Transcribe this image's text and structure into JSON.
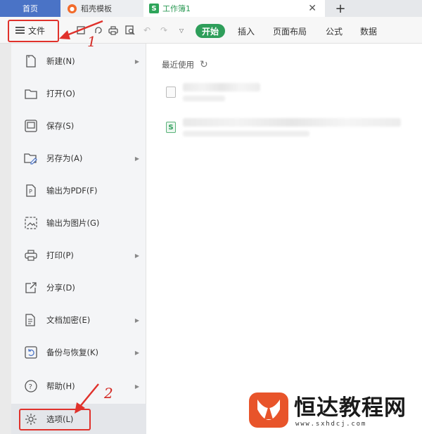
{
  "tabs": {
    "home": "首页",
    "docer": "稻壳模板",
    "workbook": "工作簿1",
    "close_glyph": "✕",
    "add_glyph": "+"
  },
  "toolbar": {
    "file_label": "文件",
    "ribbon": [
      "开始",
      "插入",
      "页面布局",
      "公式",
      "数据"
    ]
  },
  "menu": [
    {
      "label": "新建(N)",
      "icon": "new-file-icon",
      "submenu": true
    },
    {
      "label": "打开(O)",
      "icon": "folder-open-icon",
      "submenu": false
    },
    {
      "label": "保存(S)",
      "icon": "save-icon",
      "submenu": false
    },
    {
      "label": "另存为(A)",
      "icon": "save-as-icon",
      "submenu": true
    },
    {
      "label": "输出为PDF(F)",
      "icon": "pdf-export-icon",
      "submenu": false
    },
    {
      "label": "输出为图片(G)",
      "icon": "image-export-icon",
      "submenu": false
    },
    {
      "label": "打印(P)",
      "icon": "printer-icon",
      "submenu": true
    },
    {
      "label": "分享(D)",
      "icon": "share-icon",
      "submenu": false
    },
    {
      "label": "文档加密(E)",
      "icon": "encrypt-icon",
      "submenu": true
    },
    {
      "label": "备份与恢复(K)",
      "icon": "backup-icon",
      "submenu": true
    },
    {
      "label": "帮助(H)",
      "icon": "help-icon",
      "submenu": true
    },
    {
      "label": "选项(L)",
      "icon": "gear-icon",
      "submenu": false
    }
  ],
  "main": {
    "recent_title": "最近使用"
  },
  "annotations": {
    "step1": "1",
    "step2": "2",
    "color": "#e0312b"
  },
  "watermark": {
    "name": "恒达教程网",
    "url": "www.sxhdcj.com"
  },
  "colors": {
    "accent_green": "#2e9e5a",
    "home_tab_blue": "#4a73c6",
    "docer_orange": "#f26b2b"
  }
}
